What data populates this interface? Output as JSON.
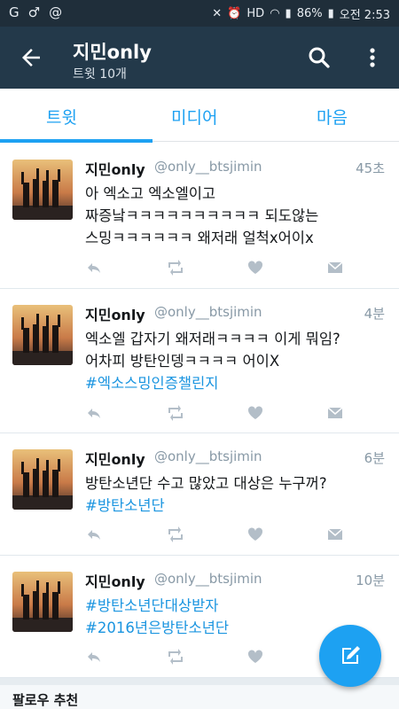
{
  "status_bar": {
    "left_icons": [
      "carrier-g-icon",
      "gender-icon",
      "at-icon"
    ],
    "battery": "86%",
    "time": "오전 2:53"
  },
  "header": {
    "title": "지민only",
    "subtitle": "트윗 10개"
  },
  "tabs": [
    {
      "label": "트윗",
      "active": true
    },
    {
      "label": "미디어",
      "active": false
    },
    {
      "label": "마음",
      "active": false
    }
  ],
  "tweets": [
    {
      "name": "지민only",
      "handle": "@only__btsjimin",
      "time": "45초",
      "lines": [
        "아 엑소고 엑소엘이고",
        "짜증낰ㅋㅋㅋㅋㅋㅋㅋㅋㅋㅋ 되도않는",
        "스밍ㅋㅋㅋㅋㅋㅋ 왜저래 얼척x어이x"
      ],
      "hashtags": []
    },
    {
      "name": "지민only",
      "handle": "@only__btsjimin",
      "time": "4분",
      "lines": [
        "엑소엘 갑자기 왜저래ㅋㅋㅋㅋ 이게 뭐임?",
        "어차피 방탄인뎅ㅋㅋㅋㅋ 어이X"
      ],
      "hashtags": [
        "#엑소스밍인증챌린지"
      ]
    },
    {
      "name": "지민only",
      "handle": "@only__btsjimin",
      "time": "6분",
      "lines": [
        "방탄소년단 수고 많았고 대상은 누구꺼?"
      ],
      "hashtags": [
        "#방탄소년단"
      ]
    },
    {
      "name": "지민only",
      "handle": "@only__btsjimin",
      "time": "10분",
      "lines": [],
      "hashtags": [
        "#방탄소년단대상받자",
        "#2016년은방탄소년단"
      ]
    }
  ],
  "suggestions": {
    "label": "팔로우 추천"
  },
  "colors": {
    "status_bar": "#1f2e3a",
    "app_bar": "#23394a",
    "accent": "#1da1f2",
    "hashtag": "#1b95e0",
    "muted": "#8899a6"
  }
}
